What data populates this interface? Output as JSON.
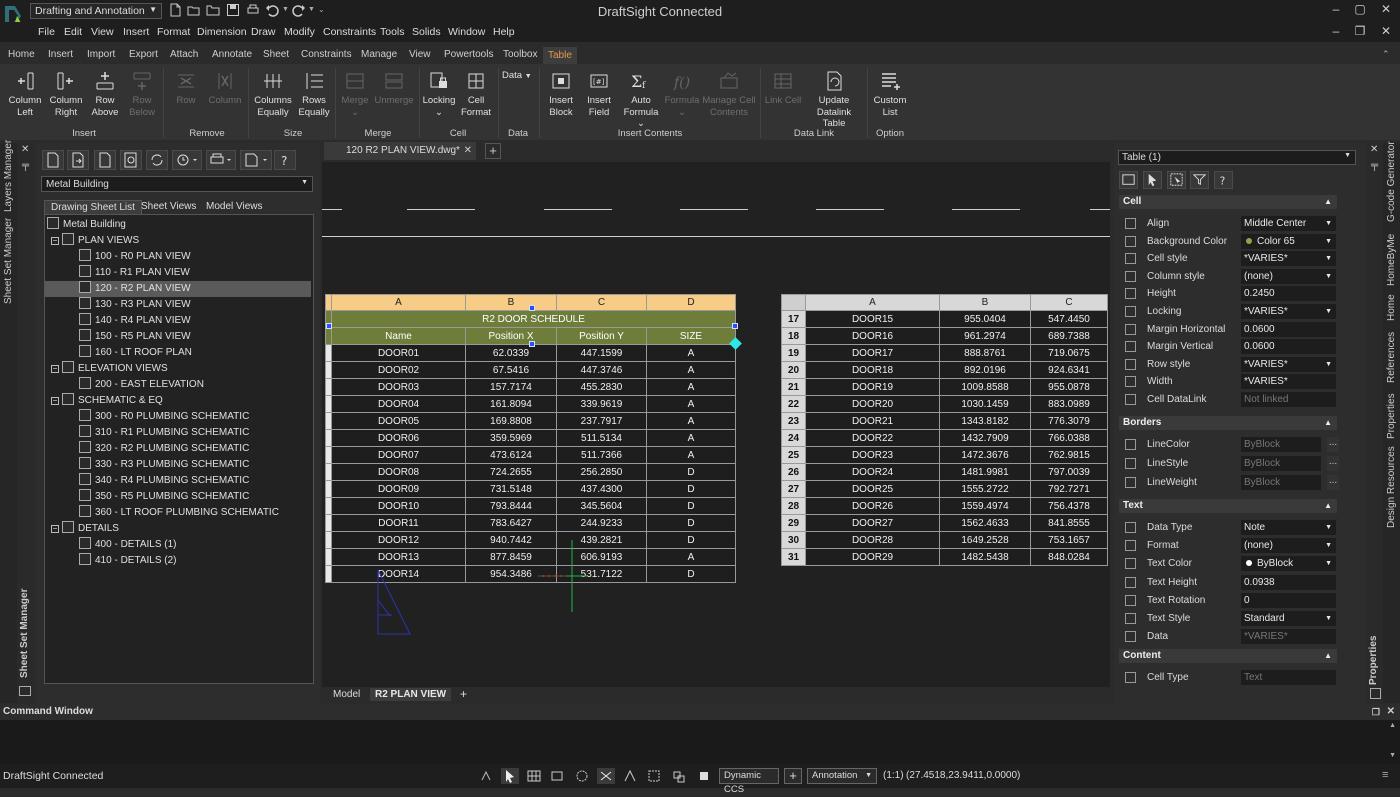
{
  "app": {
    "title": "DraftSight Connected",
    "workspace": "Drafting and Annotation"
  },
  "menu": [
    "File",
    "Edit",
    "View",
    "Insert",
    "Format",
    "Dimension",
    "Draw",
    "Modify",
    "Constraints",
    "Tools",
    "Solids",
    "Window",
    "Help"
  ],
  "ribbon_tabs": [
    "Home",
    "Insert",
    "Import",
    "Export",
    "Attach",
    "Annotate",
    "Sheet",
    "Constraints",
    "Manage",
    "View",
    "Powertools",
    "Toolbox",
    "Table"
  ],
  "ribbon": {
    "buttons": [
      {
        "l1": "Column",
        "l2": "Left"
      },
      {
        "l1": "Column",
        "l2": "Right"
      },
      {
        "l1": "Row",
        "l2": "Above"
      },
      {
        "l1": "Row",
        "l2": "Below"
      },
      {
        "l1": "Row",
        "l2": ""
      },
      {
        "l1": "Column",
        "l2": ""
      },
      {
        "l1": "Columns",
        "l2": "Equally"
      },
      {
        "l1": "Rows",
        "l2": "Equally"
      },
      {
        "l1": "Merge",
        "l2": ""
      },
      {
        "l1": "Unmerge",
        "l2": ""
      },
      {
        "l1": "Locking",
        "l2": ""
      },
      {
        "l1": "Cell",
        "l2": "Format"
      },
      {
        "l1": "Data",
        "l2": ""
      },
      {
        "l1": "Insert",
        "l2": "Block"
      },
      {
        "l1": "Insert",
        "l2": "Field"
      },
      {
        "l1": "Auto",
        "l2": "Formula"
      },
      {
        "l1": "Formula",
        "l2": ""
      },
      {
        "l1": "Manage Cell",
        "l2": "Contents"
      },
      {
        "l1": "Link Cell",
        "l2": ""
      },
      {
        "l1": "Update",
        "l2": "Datalink Table"
      },
      {
        "l1": "Custom",
        "l2": "List"
      }
    ],
    "groups": [
      "Insert",
      "Remove",
      "Size",
      "Merge",
      "Cell",
      "Data",
      "Insert Contents",
      "Data Link",
      "Option"
    ]
  },
  "side_tabs": {
    "left": [
      "Layers Manager",
      "Sheet Set Manager"
    ],
    "left_bottom": "Sheet Set Manager",
    "right": [
      "G-code Generator",
      "HomeByMe",
      "Home",
      "References",
      "Properties",
      "Design Resources"
    ],
    "right_bottom": "Properties"
  },
  "sheet_set": {
    "selector": "Metal Building",
    "tabs": [
      "Drawing Sheet List",
      "Sheet Views",
      "Model Views"
    ],
    "tree": [
      {
        "t": "Metal Building",
        "lvl": 0,
        "k": "root"
      },
      {
        "t": "PLAN VIEWS",
        "lvl": 1,
        "k": "grp"
      },
      {
        "t": "100 - R0 PLAN VIEW",
        "lvl": 2
      },
      {
        "t": "110 - R1 PLAN VIEW",
        "lvl": 2
      },
      {
        "t": "120 - R2 PLAN VIEW",
        "lvl": 2,
        "sel": true
      },
      {
        "t": "130 - R3 PLAN VIEW",
        "lvl": 2
      },
      {
        "t": "140 - R4 PLAN VIEW",
        "lvl": 2
      },
      {
        "t": "150 - R5 PLAN VIEW",
        "lvl": 2
      },
      {
        "t": "160 - LT ROOF PLAN",
        "lvl": 2
      },
      {
        "t": "ELEVATION VIEWS",
        "lvl": 1,
        "k": "grp"
      },
      {
        "t": "200 - EAST ELEVATION",
        "lvl": 2
      },
      {
        "t": "SCHEMATIC & EQ",
        "lvl": 1,
        "k": "grp"
      },
      {
        "t": "300 - R0 PLUMBING SCHEMATIC",
        "lvl": 2
      },
      {
        "t": "310 - R1 PLUMBING SCHEMATIC",
        "lvl": 2
      },
      {
        "t": "320 - R2 PLUMBING SCHEMATIC",
        "lvl": 2
      },
      {
        "t": "330 - R3 PLUMBING SCHEMATIC",
        "lvl": 2
      },
      {
        "t": "340 - R4 PLUMBING SCHEMATIC",
        "lvl": 2
      },
      {
        "t": "350 - R5 PLUMBING SCHEMATIC",
        "lvl": 2
      },
      {
        "t": "360 - LT ROOF PLUMBING SCHEMATIC",
        "lvl": 2
      },
      {
        "t": "DETAILS",
        "lvl": 1,
        "k": "grp"
      },
      {
        "t": "400 - DETAILS (1)",
        "lvl": 2
      },
      {
        "t": "410 - DETAILS (2)",
        "lvl": 2
      }
    ]
  },
  "document": {
    "tab": "120 R2 PLAN VIEW.dwg*",
    "layout_tabs": [
      "Model",
      "R2 PLAN VIEW"
    ]
  },
  "table1": {
    "col_letters": [
      "A",
      "B",
      "C",
      "D"
    ],
    "title": "R2 DOOR SCHEDULE",
    "headers": [
      "Name",
      "Position X",
      "Position Y",
      "SIZE"
    ],
    "rows": [
      [
        "DOOR01",
        "62.0339",
        "447.1599",
        "A"
      ],
      [
        "DOOR02",
        "67.5416",
        "447.3746",
        "A"
      ],
      [
        "DOOR03",
        "157.7174",
        "455.2830",
        "A"
      ],
      [
        "DOOR04",
        "161.8094",
        "339.9619",
        "A"
      ],
      [
        "DOOR05",
        "169.8808",
        "237.7917",
        "A"
      ],
      [
        "DOOR06",
        "359.5969",
        "511.5134",
        "A"
      ],
      [
        "DOOR07",
        "473.6124",
        "511.7366",
        "A"
      ],
      [
        "DOOR08",
        "724.2655",
        "256.2850",
        "D"
      ],
      [
        "DOOR09",
        "731.5148",
        "437.4300",
        "D"
      ],
      [
        "DOOR10",
        "793.8444",
        "345.5604",
        "D"
      ],
      [
        "DOOR11",
        "783.6427",
        "244.9233",
        "D"
      ],
      [
        "DOOR12",
        "940.7442",
        "439.2821",
        "D"
      ],
      [
        "DOOR13",
        "877.8459",
        "606.9193",
        "A"
      ],
      [
        "DOOR14",
        "954.3486",
        "531.7122",
        "D"
      ]
    ]
  },
  "table2": {
    "col_letters": [
      "A",
      "B",
      "C"
    ],
    "rows": [
      [
        "17",
        "DOOR15",
        "955.0404",
        "547.4450"
      ],
      [
        "18",
        "DOOR16",
        "961.2974",
        "689.7388"
      ],
      [
        "19",
        "DOOR17",
        "888.8761",
        "719.0675"
      ],
      [
        "20",
        "DOOR18",
        "892.0196",
        "924.6341"
      ],
      [
        "21",
        "DOOR19",
        "1009.8588",
        "955.0878"
      ],
      [
        "22",
        "DOOR20",
        "1030.1459",
        "883.0989"
      ],
      [
        "23",
        "DOOR21",
        "1343.8182",
        "776.3079"
      ],
      [
        "24",
        "DOOR22",
        "1432.7909",
        "766.0388"
      ],
      [
        "25",
        "DOOR23",
        "1472.3676",
        "762.9815"
      ],
      [
        "26",
        "DOOR24",
        "1481.9981",
        "797.0039"
      ],
      [
        "27",
        "DOOR25",
        "1555.2722",
        "792.7271"
      ],
      [
        "28",
        "DOOR26",
        "1559.4974",
        "756.4378"
      ],
      [
        "29",
        "DOOR27",
        "1562.4633",
        "841.8555"
      ],
      [
        "30",
        "DOOR28",
        "1649.2528",
        "753.1657"
      ],
      [
        "31",
        "DOOR29",
        "1482.5438",
        "848.0284"
      ]
    ]
  },
  "properties": {
    "selector": "Table (1)",
    "sections": [
      {
        "name": "Cell",
        "rows": [
          {
            "n": "Align",
            "v": "Middle Center",
            "dd": true
          },
          {
            "n": "Background Color",
            "v": "Color 65",
            "dd": true,
            "dot": "#8fa34a"
          },
          {
            "n": "Cell style",
            "v": "*VARIES*",
            "dd": true
          },
          {
            "n": "Column style",
            "v": "(none)",
            "dd": true
          },
          {
            "n": "Height",
            "v": "0.2450"
          },
          {
            "n": "Locking",
            "v": "*VARIES*",
            "dd": true
          },
          {
            "n": "Margin Horizontal",
            "v": "0.0600"
          },
          {
            "n": "Margin Vertical",
            "v": "0.0600"
          },
          {
            "n": "Row style",
            "v": "*VARIES*",
            "dd": true
          },
          {
            "n": "Width",
            "v": "*VARIES*"
          },
          {
            "n": "Cell DataLink",
            "v": "Not linked",
            "dim": true
          }
        ]
      },
      {
        "name": "Borders",
        "rows": [
          {
            "n": "LineColor",
            "v": "ByBlock",
            "dim": true,
            "dots": true
          },
          {
            "n": "LineStyle",
            "v": "ByBlock",
            "dim": true,
            "dots": true
          },
          {
            "n": "LineWeight",
            "v": "ByBlock",
            "dim": true,
            "dots": true
          }
        ]
      },
      {
        "name": "Text",
        "rows": [
          {
            "n": "Data Type",
            "v": "Note",
            "dd": true
          },
          {
            "n": "Format",
            "v": "(none)",
            "dd": true
          },
          {
            "n": "Text Color",
            "v": "ByBlock",
            "dd": true,
            "dot": "#ffffff"
          },
          {
            "n": "Text Height",
            "v": "0.0938"
          },
          {
            "n": "Text Rotation",
            "v": "0"
          },
          {
            "n": "Text Style",
            "v": "Standard",
            "dd": true
          },
          {
            "n": "Data",
            "v": "*VARIES*",
            "dim": true
          }
        ]
      },
      {
        "name": "Content",
        "rows": [
          {
            "n": "Cell Type",
            "v": "Text",
            "dim": true
          }
        ]
      }
    ]
  },
  "command_window": {
    "title": "Command Window"
  },
  "status": {
    "text": "DraftSight Connected",
    "ccs": "Dynamic CCS",
    "annotation": "Annotation",
    "scale": "(1:1)",
    "coords": "(27.4518,23.9411,0.0000)"
  },
  "colors": {
    "accent": "#e39a4a",
    "header_orange": "#f7cc86",
    "title_green": "#6f7d3a",
    "grip_blue": "#2a4fff"
  }
}
